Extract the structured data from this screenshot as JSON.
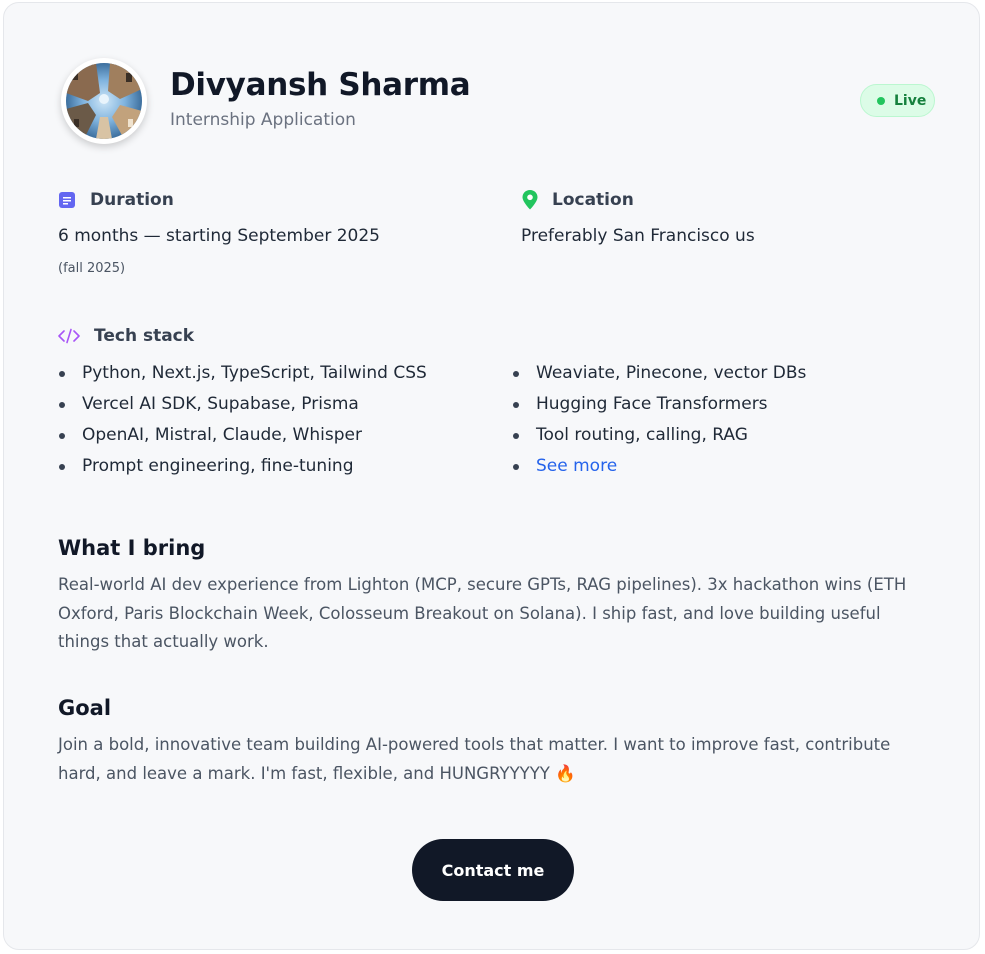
{
  "profile": {
    "name": "Divyansh Sharma",
    "subtitle": "Internship Application",
    "status": "Live",
    "avatar_icon": "avatar-photo"
  },
  "duration": {
    "heading": "Duration",
    "icon": "calendar-icon",
    "value": "6 months — starting September 2025",
    "note": "(fall 2025)"
  },
  "location": {
    "heading": "Location",
    "icon": "map-pin-icon",
    "value": "Preferably San Francisco us"
  },
  "tech_stack": {
    "heading": "Tech stack",
    "icon": "code-icon",
    "left": [
      "Python, Next.js, TypeScript, Tailwind CSS",
      "Vercel AI SDK, Supabase, Prisma",
      "OpenAI, Mistral, Claude, Whisper",
      "Prompt engineering, fine-tuning"
    ],
    "right": [
      "Weaviate, Pinecone, vector DBs",
      "Hugging Face Transformers",
      "Tool routing, calling, RAG"
    ],
    "see_more": "See more"
  },
  "what_i_bring": {
    "heading": "What I bring",
    "text": "Real-world AI dev experience from Lighton (MCP, secure GPTs, RAG pipelines). 3x hackathon wins (ETH Oxford, Paris Blockchain Week, Colosseum Breakout on Solana). I ship fast, and love building useful things that actually work."
  },
  "goal": {
    "heading": "Goal",
    "text": "Join a bold, innovative team building AI-powered tools that matter. I want to improve fast, contribute hard, and leave a mark. I'm fast, flexible, and HUNGRYYYYY 🔥"
  },
  "cta": {
    "label": "Contact me"
  },
  "colors": {
    "card_background": "#f7f8fa",
    "primary_text": "#111827",
    "muted_text": "#6b7280",
    "live_green": "#22c55e",
    "link_blue": "#2563eb",
    "calendar_icon": "#6366f1",
    "location_icon": "#22c55e",
    "code_icon": "#a855f7",
    "button_background": "#111827"
  }
}
